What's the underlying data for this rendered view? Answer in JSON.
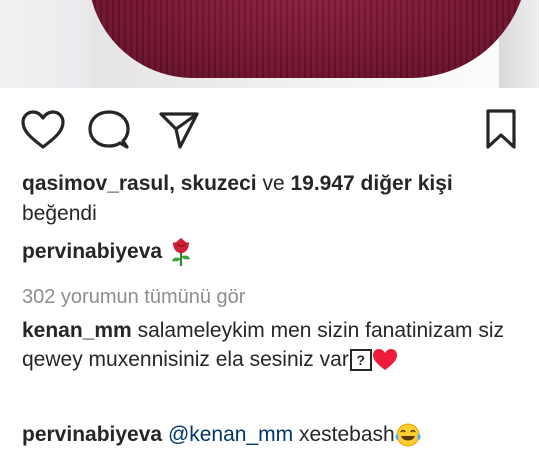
{
  "post": {
    "likes": {
      "likers": "qasimov_rasul, skuzeci",
      "connector": " ve ",
      "count_text": "19.947 diğer kişi",
      "suffix": "beğendi"
    },
    "caption": {
      "username": "pervinabiyeva",
      "emoji": "rose-emoji"
    },
    "view_all_comments": "302 yorumun tümünü gör",
    "comments": [
      {
        "username": "kenan_mm",
        "text": "salameleykim men sizin fanatinizam siz qewey muxennisiniz ela sesiniz var",
        "emojis": [
          "question-box-emoji",
          "red-heart-emoji"
        ],
        "unknown_glyph": "?"
      },
      {
        "username": "pervinabiyeva",
        "mention": "@kenan_mm",
        "text": "xestebash",
        "emoji": "tears-of-joy-emoji"
      }
    ]
  },
  "icons": {
    "like": "heart-icon",
    "comment": "comment-icon",
    "share": "send-icon",
    "save": "bookmark-icon"
  },
  "colors": {
    "text": "#262626",
    "secondary_text": "#8e8e8e",
    "mention": "#003569",
    "heart": "#ed1c3a",
    "sweater": "#74142f"
  }
}
